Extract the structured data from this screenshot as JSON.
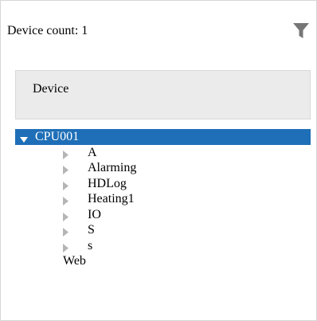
{
  "panel": {
    "device_count_label": "Device count: 1",
    "filter_icon": "filter-icon"
  },
  "column_header": {
    "label": "Device"
  },
  "tree": {
    "root": {
      "label": "CPU001",
      "expanded": true,
      "selected": true,
      "selection_color": "#1e6fb7"
    },
    "children": [
      {
        "label": "A",
        "has_children": true
      },
      {
        "label": "Alarming",
        "has_children": true
      },
      {
        "label": "HDLog",
        "has_children": true
      },
      {
        "label": "Heating1",
        "has_children": true
      },
      {
        "label": "IO",
        "has_children": true
      },
      {
        "label": "S",
        "has_children": true
      },
      {
        "label": "s",
        "has_children": true
      },
      {
        "label": "Web",
        "has_children": false
      }
    ]
  }
}
